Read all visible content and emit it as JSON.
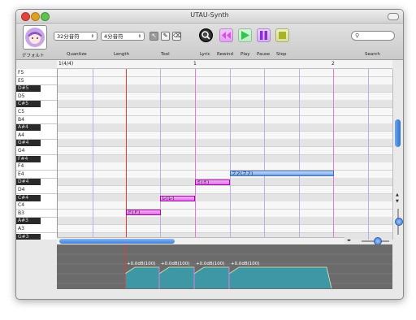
{
  "window": {
    "title": "UTAU-Synth"
  },
  "toolbar": {
    "singer_label": "デフォルト",
    "quantize_label": "Quantize",
    "quantize_value": "32分音符",
    "length_label": "Length",
    "length_value": "4分音符",
    "tool_label": "Tool",
    "lyric_label": "Lyric",
    "rewind_label": "Rewind",
    "play_label": "Play",
    "pause_label": "Pause",
    "stop_label": "Stop",
    "search_label": "Search",
    "search_value": ""
  },
  "ruler": {
    "time_sig": "1(4/4)",
    "bar1": "1",
    "bar2": "2"
  },
  "keys": [
    {
      "label": "F5",
      "black": false
    },
    {
      "label": "E5",
      "black": false
    },
    {
      "label": "D#5",
      "black": true
    },
    {
      "label": "D5",
      "black": false
    },
    {
      "label": "C#5",
      "black": true
    },
    {
      "label": "C5",
      "black": false
    },
    {
      "label": "B4",
      "black": false
    },
    {
      "label": "A#4",
      "black": true
    },
    {
      "label": "A4",
      "black": false
    },
    {
      "label": "G#4",
      "black": true
    },
    {
      "label": "G4",
      "black": false
    },
    {
      "label": "F#4",
      "black": true
    },
    {
      "label": "F4",
      "black": false
    },
    {
      "label": "E4",
      "black": false
    },
    {
      "label": "D#4",
      "black": true
    },
    {
      "label": "D4",
      "black": false
    },
    {
      "label": "C#4",
      "black": true
    },
    {
      "label": "C4",
      "black": false
    },
    {
      "label": "B3",
      "black": false
    },
    {
      "label": "A#3",
      "black": true
    },
    {
      "label": "A3",
      "black": false
    },
    {
      "label": "G#3",
      "black": true
    }
  ],
  "notes": [
    {
      "label": "ド(ド)"
    },
    {
      "label": "レ(レ)"
    },
    {
      "label": "ミ(ミ)"
    },
    {
      "label": "ファ(ファ)"
    }
  ],
  "volumes": [
    "+0.0dB(100)",
    "+0.0dB(100)",
    "+0.0dB(100)",
    "+0.0dB(100)"
  ],
  "colors": {
    "accent_play": "#2ec74e",
    "accent_rewind": "#d84fe6",
    "accent_pause": "#8e2bd6",
    "accent_stop": "#a8b424",
    "note_pink": "#e070e8",
    "note_blue": "#6a9ee8"
  }
}
